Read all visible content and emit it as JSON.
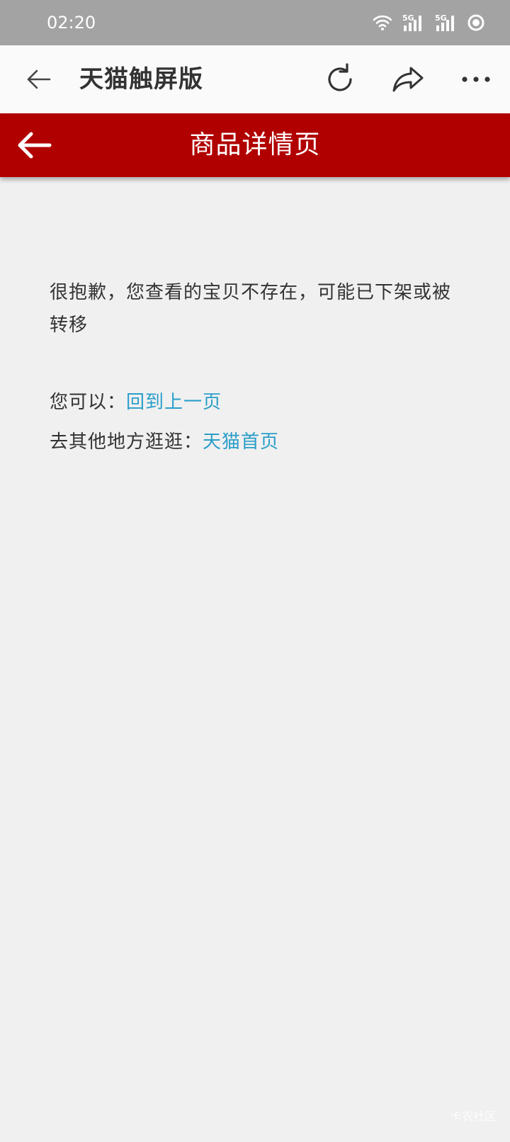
{
  "status_bar": {
    "time": "02:20",
    "icons": [
      "wifi-icon",
      "signal-5g-icon",
      "signal-5g-icon",
      "dnd-icon"
    ],
    "network_label": "5G"
  },
  "browser": {
    "title": "天猫触屏版",
    "icons": [
      "back-arrow-icon",
      "refresh-icon",
      "share-icon",
      "more-icon"
    ]
  },
  "header": {
    "title": "商品详情页",
    "background_color": "#b10000"
  },
  "content": {
    "message": "很抱歉，您查看的宝贝不存在，可能已下架或被转移",
    "option1_prefix": "您可以：",
    "option1_link": "回到上一页",
    "option2_prefix": "去其他地方逛逛：",
    "option2_link": "天猫首页",
    "link_color": "#2a9ec9"
  },
  "watermark": "卡农社区"
}
